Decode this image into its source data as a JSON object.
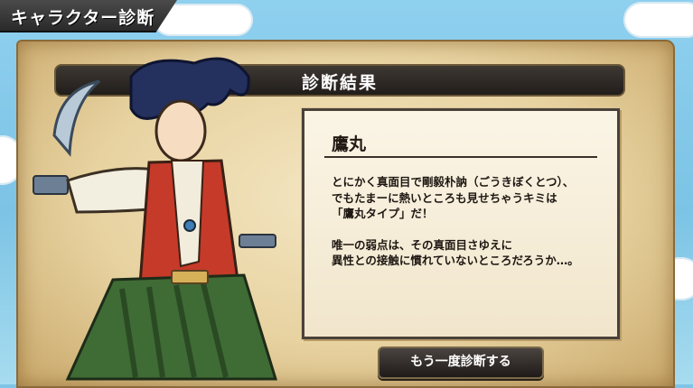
{
  "corner": {
    "title": "キャラクター診断"
  },
  "header": {
    "title": "診断結果"
  },
  "result": {
    "name": "鷹丸",
    "description": [
      "とにかく真面目で剛毅朴訥（ごうきぼくとつ）、",
      "でもたまーに熱いところも見せちゃうキミは",
      "「鷹丸タイプ」だ！",
      "",
      "唯一の弱点は、その真面目さゆえに",
      "異性との接触に慣れていないところだろうか…。"
    ]
  },
  "retry_button": {
    "label": "もう一度診断する"
  },
  "colors": {
    "panel_border": "#4a4138",
    "parchment": "#ecd9ab",
    "sky": "#7fc4e6"
  },
  "icons": [
    "samurai-character-illustration"
  ]
}
